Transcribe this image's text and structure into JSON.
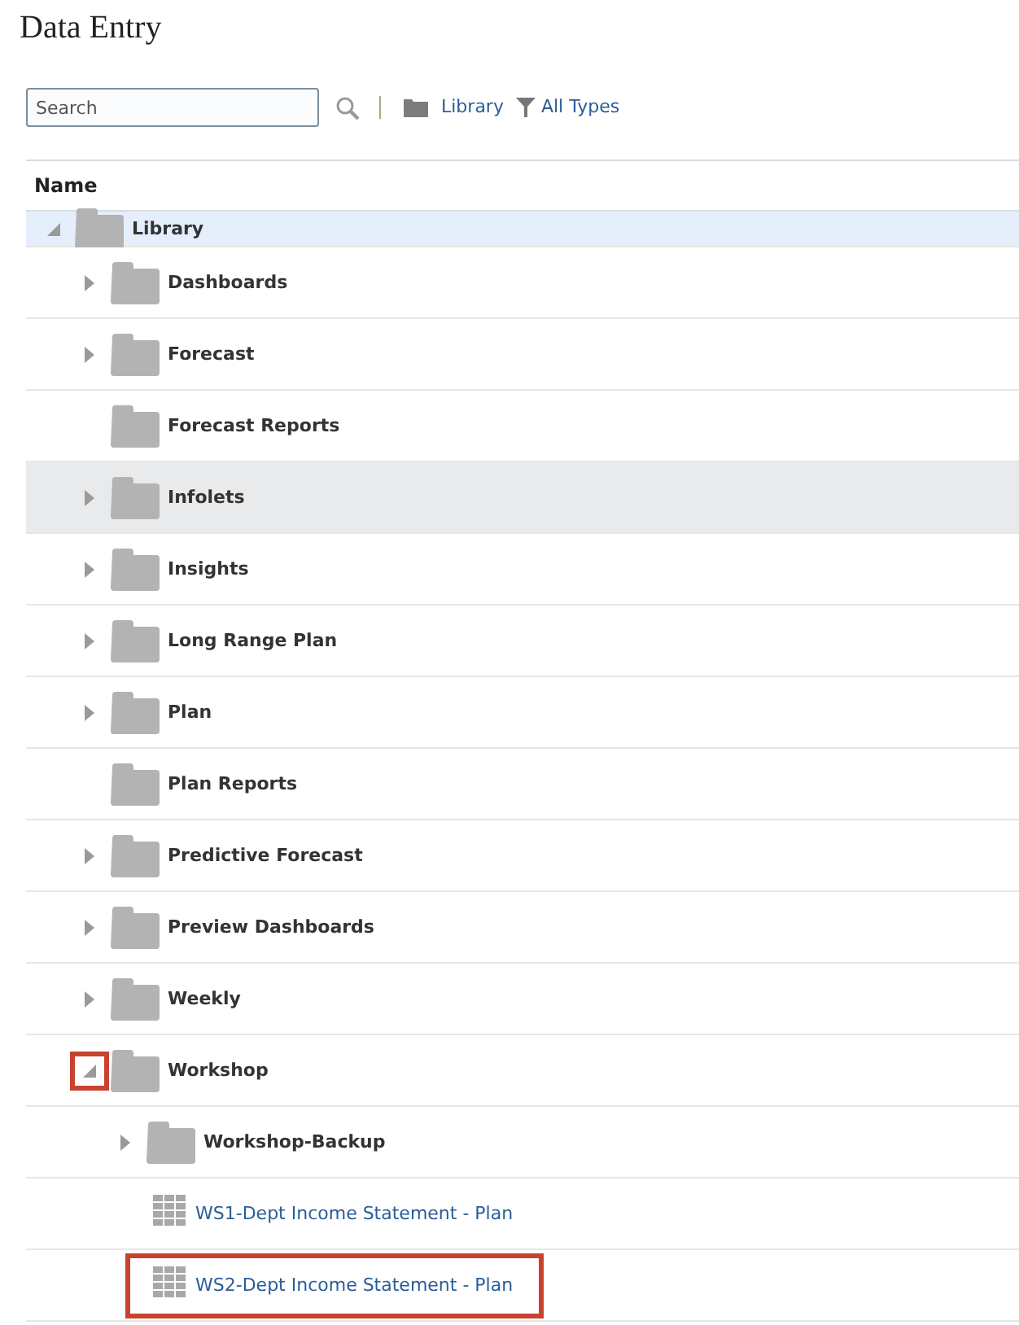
{
  "page_title": "Data Entry",
  "toolbar": {
    "search": {
      "placeholder": "Search"
    },
    "location": "Library",
    "filter": "All Types"
  },
  "table": {
    "columns": [
      "Name"
    ],
    "tree": [
      {
        "name": "Library",
        "kind": "folder",
        "expanded": true,
        "selected": true,
        "children": [
          {
            "name": "Dashboards",
            "kind": "folder",
            "expanded": false,
            "selected": false
          },
          {
            "name": "Forecast",
            "kind": "folder",
            "expanded": false,
            "selected": false
          },
          {
            "name": "Forecast Reports",
            "kind": "folder",
            "selected": false
          },
          {
            "name": "Infolets",
            "kind": "folder",
            "expanded": false,
            "selected": false,
            "highlighted": true
          },
          {
            "name": "Insights",
            "kind": "folder",
            "expanded": false,
            "selected": false
          },
          {
            "name": "Long Range Plan",
            "kind": "folder",
            "expanded": false,
            "selected": false
          },
          {
            "name": "Plan",
            "kind": "folder",
            "expanded": false,
            "selected": false
          },
          {
            "name": "Plan Reports",
            "kind": "folder",
            "selected": false
          },
          {
            "name": "Predictive Forecast",
            "kind": "folder",
            "expanded": false,
            "selected": false
          },
          {
            "name": "Preview Dashboards",
            "kind": "folder",
            "expanded": false,
            "selected": false
          },
          {
            "name": "Weekly",
            "kind": "folder",
            "expanded": false,
            "selected": false
          },
          {
            "name": "Workshop",
            "kind": "folder",
            "expanded": true,
            "selected": false,
            "annotated": true,
            "children": [
              {
                "name": "Workshop-Backup",
                "kind": "folder",
                "expanded": false,
                "selected": false
              },
              {
                "name": "WS1-Dept Income Statement - Plan",
                "kind": "form",
                "selected": false
              },
              {
                "name": "WS2-Dept Income Statement - Plan",
                "kind": "form",
                "selected": false,
                "annotated": true
              }
            ]
          }
        ]
      }
    ]
  }
}
